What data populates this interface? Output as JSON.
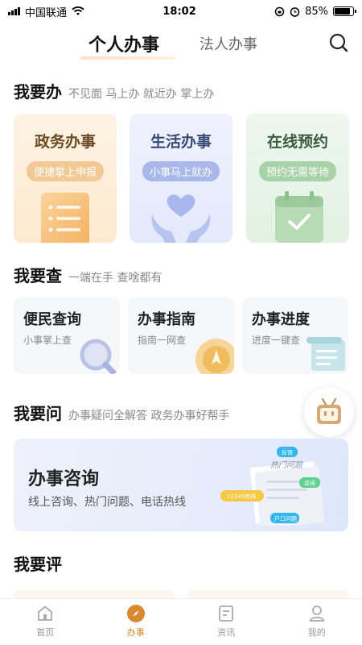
{
  "status_bar": {
    "carrier": "中国联通",
    "time": "18:02",
    "battery": "85%",
    "battery_level": 0.85
  },
  "top_tabs": {
    "active": "个人办事",
    "other": "法人办事"
  },
  "section_do": {
    "title": "我要办",
    "subtitle": "不见面 马上办 就近办 掌上办",
    "cards": [
      {
        "title": "政务办事",
        "tag": "便捷掌上申报"
      },
      {
        "title": "生活办事",
        "tag": "小事马上就办"
      },
      {
        "title": "在线预约",
        "tag": "预约无需等待"
      }
    ]
  },
  "section_check": {
    "title": "我要查",
    "subtitle": "一端在手 查啥都有",
    "cards": [
      {
        "title": "便民查询",
        "tag": "小事掌上查"
      },
      {
        "title": "办事指南",
        "tag": "指南一网查"
      },
      {
        "title": "办事进度",
        "tag": "进度一键查"
      }
    ]
  },
  "section_ask": {
    "title": "我要问",
    "subtitle": "办事疑问全解答 政务办事好帮手",
    "banner": {
      "title": "办事咨询",
      "desc": "线上咨询、热门问题、电话热线",
      "art_labels": {
        "paper": "热门问题",
        "b1": "反馈",
        "b2": "咨询",
        "b3": "12345热线",
        "b4": "户口问题"
      }
    }
  },
  "section_eval": {
    "title": "我要评"
  },
  "tabbar": [
    {
      "label": "首页",
      "icon": "home-icon"
    },
    {
      "label": "办事",
      "icon": "compass-icon"
    },
    {
      "label": "资讯",
      "icon": "news-icon"
    },
    {
      "label": "我的",
      "icon": "user-icon"
    }
  ],
  "colors": {
    "accent": "#d9892f",
    "orange_card": "#fdf0de",
    "blue_card": "#eef1fc",
    "green_card": "#eaf5ea"
  }
}
